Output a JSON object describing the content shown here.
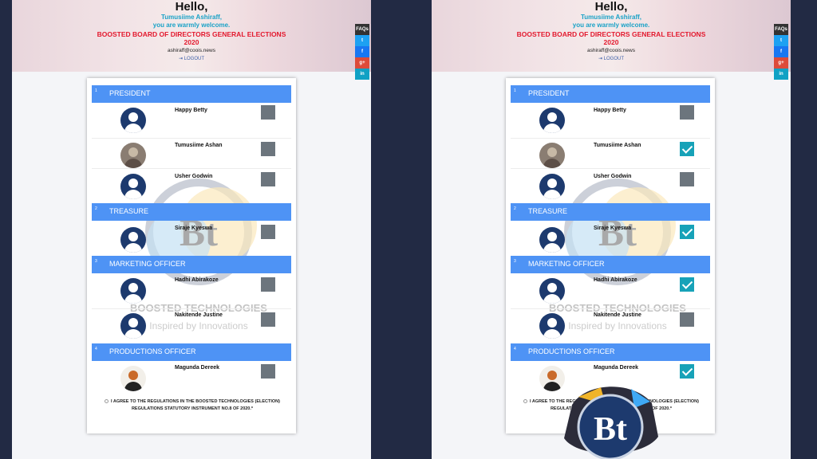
{
  "header": {
    "greeting": "Hello,",
    "user_name": "Tumusiime Ashiraff,",
    "welcome": "you are warmly welcome.",
    "election_title": "BOOSTED BOARD OF DIRECTORS GENERAL ELECTIONS 2020",
    "email": "ashiraff@coois.news",
    "logout": "LOGOUT"
  },
  "social": {
    "faq": "FAQs",
    "twitter": "t",
    "facebook": "f",
    "googleplus": "g+",
    "linkedin": "in"
  },
  "positions": [
    {
      "num": "1",
      "title": "PRESIDENT"
    },
    {
      "num": "2",
      "title": "TREASURE"
    },
    {
      "num": "3",
      "title": "MARKETING OFFICER"
    },
    {
      "num": "4",
      "title": "PRODUCTIONS OFFICER"
    }
  ],
  "candidates": [
    {
      "name": "Happy Betty"
    },
    {
      "name": "Tumusiime Ashan"
    },
    {
      "name": "Usher Godwin"
    },
    {
      "name": "Siraje Kyeswa"
    },
    {
      "name": "Hadhi Abirakoze"
    },
    {
      "name": "Nakitende Justine"
    },
    {
      "name": "Magunda Dereek"
    }
  ],
  "watermark": {
    "brand": "BOOSTED TECHNOLOGIES",
    "tagline": "Inspired by Innovations",
    "initials": "Bt"
  },
  "agreement": "I AGREE TO THE REGULATIONS IN THE BOOSTED TECHNOLOGIES (ELECTION) REGULATIONS STATUTORY INSTRUMENT NO.8 OF 2020.*",
  "votes_before": [
    false,
    false,
    false,
    false,
    false,
    false,
    false
  ],
  "votes_after": [
    false,
    true,
    false,
    true,
    true,
    false,
    true
  ],
  "colors": {
    "position_header": "#4e93f5",
    "checked": "#17a2b8",
    "unchecked": "#6c757d",
    "title_red": "#e3182d",
    "name_teal": "#1aa2c7"
  }
}
